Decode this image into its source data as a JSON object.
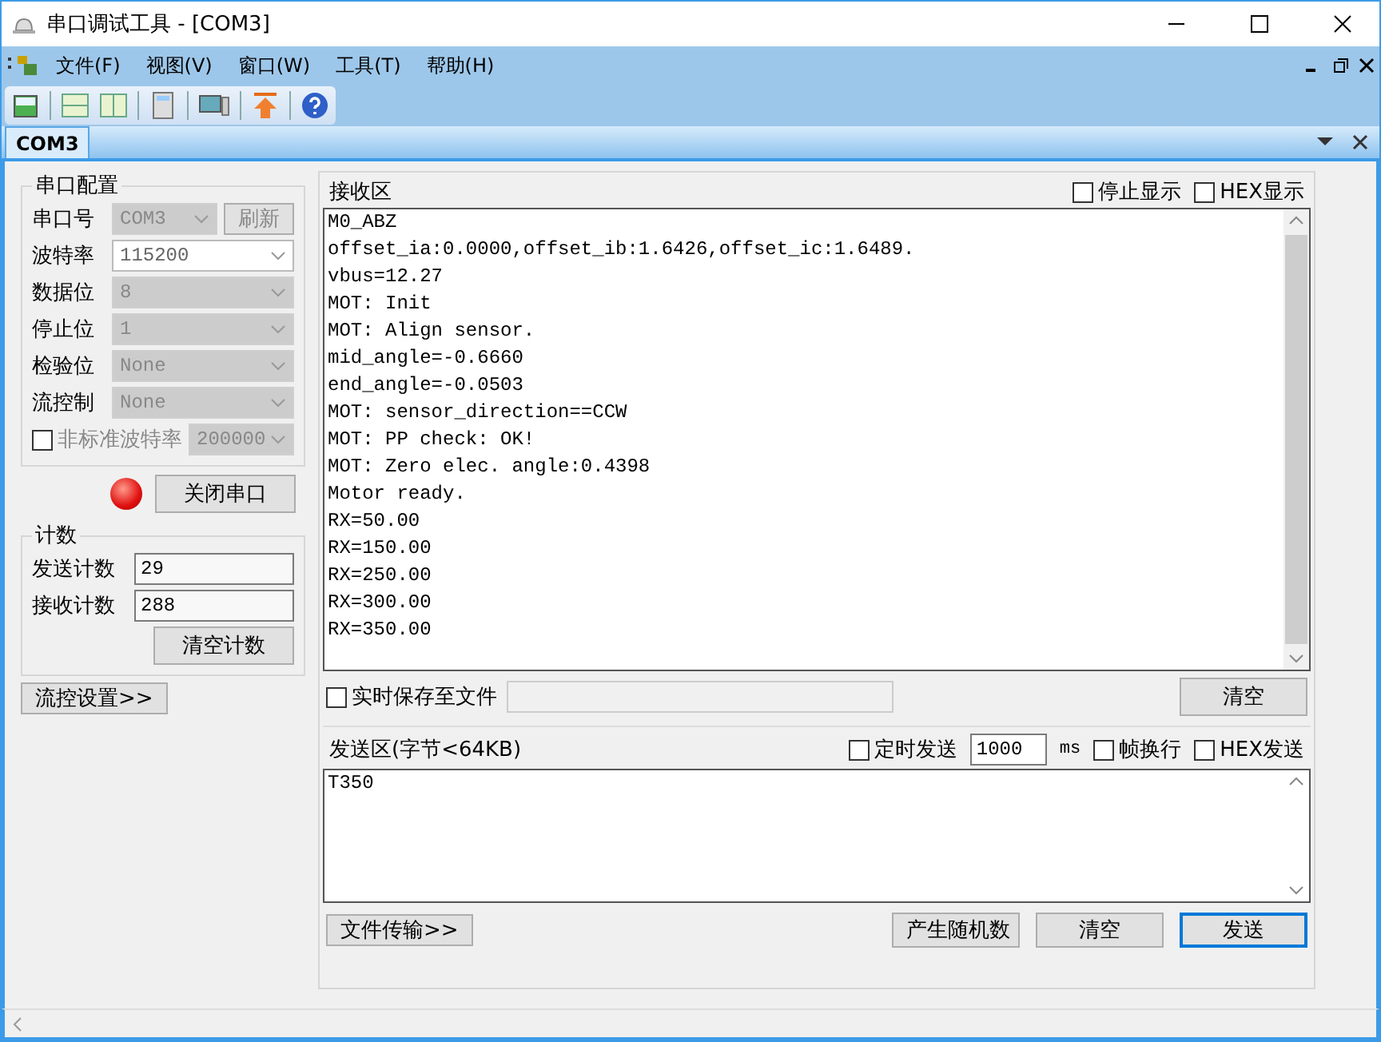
{
  "window": {
    "title": "串口调试工具 - [COM3]"
  },
  "menu": [
    "文件(F)",
    "视图(V)",
    "窗口(W)",
    "工具(T)",
    "帮助(H)"
  ],
  "doc_tab": {
    "label": "COM3",
    "selected": true
  },
  "serial_config": {
    "title": "串口配置",
    "fields": [
      {
        "label": "串口号",
        "value": "COM3",
        "disabled": true
      },
      {
        "label": "波特率",
        "value": "115200",
        "disabled": false
      },
      {
        "label": "数据位",
        "value": "8",
        "disabled": true
      },
      {
        "label": "停止位",
        "value": "1",
        "disabled": true
      },
      {
        "label": "检验位",
        "value": "None",
        "disabled": true
      },
      {
        "label": "流控制",
        "value": "None",
        "disabled": true
      }
    ],
    "refresh_button": "刷新",
    "nonstandard": {
      "label": "非标准波特率",
      "checked": false,
      "value": "200000"
    }
  },
  "port_open": true,
  "close_button": "关闭串口",
  "counts": {
    "title": "计数",
    "sent_label": "发送计数",
    "sent": "29",
    "recv_label": "接收计数",
    "recv": "288"
  },
  "clear_count_button": "清空计数",
  "flow_button": "流控设置>>",
  "receive": {
    "title": "接收区",
    "options": [
      {
        "label": "停止显示",
        "checked": false
      },
      {
        "label": "HEX显示",
        "checked": false
      }
    ],
    "lines": [
      "M0_ABZ",
      "offset_ia:0.0000,offset_ib:1.6426,offset_ic:1.6489.",
      "vbus=12.27",
      "MOT: Init",
      "MOT: Align sensor.",
      "mid_angle=-0.6660",
      "end_angle=-0.0503",
      "MOT: sensor_direction==CCW",
      "MOT: PP check: OK!",
      "MOT: Zero elec. angle:0.4398",
      "Motor ready.",
      "RX=50.00",
      "RX=150.00",
      "RX=250.00",
      "RX=300.00",
      "RX=350.00"
    ],
    "save_to_file": {
      "label": "实时保存至文件",
      "checked": false
    },
    "clear_button": "清空"
  },
  "send": {
    "title": "发送区(字节<64KB)",
    "timed": {
      "label": "定时发送",
      "checked": false
    },
    "interval": "1000",
    "unit": "ms",
    "options": [
      {
        "label": "帧换行",
        "checked": false
      },
      {
        "label": "HEX发送",
        "checked": false
      }
    ],
    "text": "T350",
    "file_button": "文件传输>>",
    "random_button": "产生随机数",
    "clear_button": "清空",
    "send_button": "发送"
  }
}
